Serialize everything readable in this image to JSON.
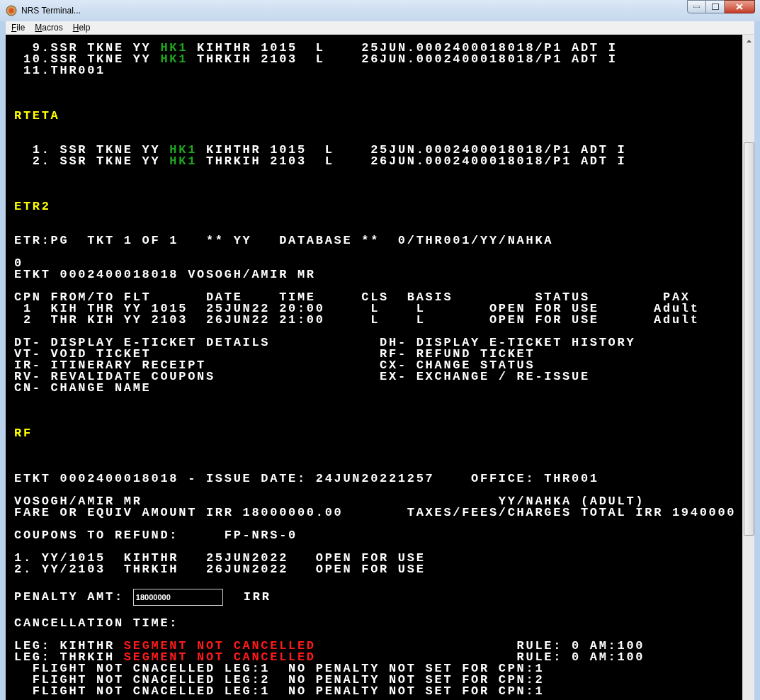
{
  "window": {
    "title": "NRS Terminal..."
  },
  "menu": [
    "File",
    "Macros",
    "Help"
  ],
  "screen": [
    {
      "kind": "text",
      "lines": [
        [
          {
            "kind": "plain",
            "text": "  9.SSR TKNE YY "
          },
          {
            "kind": "status",
            "text": "HK1"
          },
          {
            "kind": "plain",
            "text": " KIHTHR 1015  L    25JUN.0002400018018/P1 ADT I"
          }
        ],
        [
          {
            "kind": "plain",
            "text": " 10.SSR TKNE YY "
          },
          {
            "kind": "status",
            "text": "HK1"
          },
          {
            "kind": "plain",
            "text": " THRKIH 2103  L    26JUN.0002400018018/P1 ADT I"
          }
        ],
        [
          {
            "kind": "plain",
            "text": " 11.THR001"
          }
        ]
      ]
    },
    {
      "kind": "heading",
      "text": "RTETA"
    },
    {
      "kind": "text",
      "lines": [
        [
          {
            "kind": "plain",
            "text": "  1. SSR TKNE YY "
          },
          {
            "kind": "status",
            "text": "HK1"
          },
          {
            "kind": "plain",
            "text": " KIHTHR 1015  L    25JUN.0002400018018/P1 ADT I"
          }
        ],
        [
          {
            "kind": "plain",
            "text": "  2. SSR TKNE YY "
          },
          {
            "kind": "status",
            "text": "HK1"
          },
          {
            "kind": "plain",
            "text": " THRKIH 2103  L    26JUN.0002400018018/P1 ADT I"
          }
        ]
      ]
    },
    {
      "kind": "heading",
      "text": "ETR2"
    },
    {
      "kind": "text",
      "lines": [
        [
          {
            "kind": "plain",
            "text": "ETR:PG  TKT 1 OF 1   ** YY   DATABASE **  0/THR001/YY/NAHKA"
          }
        ]
      ]
    },
    {
      "kind": "text",
      "lines": [
        [
          {
            "kind": "plain",
            "text": "0"
          }
        ],
        [
          {
            "kind": "plain",
            "text": "ETKT 0002400018018 VOSOGH/AMIR MR"
          }
        ]
      ]
    },
    {
      "kind": "text",
      "lines": [
        [
          {
            "kind": "plain",
            "text": "CPN FROM/TO FLT      DATE    TIME     CLS  BASIS         STATUS        PAX"
          }
        ],
        [
          {
            "kind": "plain",
            "text": " 1  KIH THR YY 1015  25JUN22 20:00     L    L       OPEN FOR USE      Adult"
          }
        ],
        [
          {
            "kind": "plain",
            "text": " 2  THR KIH YY 2103  26JUN22 21:00     L    L       OPEN FOR USE      Adult"
          }
        ]
      ]
    },
    {
      "kind": "text",
      "lines": [
        [
          {
            "kind": "plain",
            "text": "DT- DISPLAY E-TICKET DETAILS            "
          },
          {
            "kind": "plain",
            "text": "DH- DISPLAY E-TICKET HISTORY"
          }
        ],
        [
          {
            "kind": "plain",
            "text": "VT- VOID TICKET                         "
          },
          {
            "kind": "plain",
            "text": "RF- REFUND TICKET"
          }
        ],
        [
          {
            "kind": "plain",
            "text": "IR- ITINERARY RECEIPT                   "
          },
          {
            "kind": "plain",
            "text": "CX- CHANGE STATUS"
          }
        ],
        [
          {
            "kind": "plain",
            "text": "RV- REVALIDATE COUPONS                  "
          },
          {
            "kind": "plain",
            "text": "EX- EXCHANGE / RE-ISSUE"
          }
        ],
        [
          {
            "kind": "plain",
            "text": "CN- CHANGE NAME"
          }
        ]
      ]
    },
    {
      "kind": "heading",
      "text": "RF"
    },
    {
      "kind": "report",
      "lines": [
        [
          {
            "kind": "plain",
            "text": "ETKT 0002400018018 - ISSUE DATE: 24JUN20221257    OFFICE: THR001"
          }
        ]
      ]
    },
    {
      "kind": "text",
      "lines": [
        [
          {
            "kind": "plain",
            "text": "VOSOGH/AMIR MR                                       "
          },
          {
            "kind": "plain",
            "text": "YY/NAHKA (ADULT)"
          }
        ],
        [
          {
            "kind": "plain",
            "text": "FARE OR EQUIV AMOUNT IRR 18000000.00       "
          },
          {
            "kind": "plain",
            "text": "TAXES/FEES/CHARGES TOTAL IRR 1940000"
          }
        ]
      ]
    },
    {
      "kind": "text",
      "lines": [
        [
          {
            "kind": "plain",
            "text": "COUPONS TO REFUND:     FP-NRS-0"
          }
        ]
      ]
    },
    {
      "kind": "text",
      "lines": [
        [
          {
            "kind": "plain",
            "text": "1. YY/1015  KIHTHR   25JUN2022   OPEN FOR USE"
          }
        ],
        [
          {
            "kind": "plain",
            "text": "2. YY/2103  THRKIH   26JUN2022   OPEN FOR USE"
          }
        ]
      ]
    },
    {
      "kind": "field",
      "label": "PENALTY AMT:",
      "value": "18000000",
      "unit": "IRR"
    },
    {
      "kind": "text",
      "lines": [
        [
          {
            "kind": "plain",
            "text": "CANCELLATION TIME:"
          }
        ]
      ]
    },
    {
      "kind": "text",
      "lines": [
        [
          {
            "kind": "plain",
            "text": "LEG: KIHTHR "
          },
          {
            "kind": "alert",
            "text": "SEGMENT NOT CANCELLED"
          },
          {
            "kind": "plain",
            "text": "                      RULE: 0 AM:100"
          }
        ],
        [
          {
            "kind": "plain",
            "text": "LEG: THRKIH "
          },
          {
            "kind": "alert",
            "text": "SEGMENT NOT CANCELLED"
          },
          {
            "kind": "plain",
            "text": "                      RULE: 0 AM:100"
          }
        ],
        [
          {
            "kind": "plain",
            "text": "  FLIGHT NOT CNACELLED LEG:1  NO PENALTY NOT SET FOR CPN:1"
          }
        ],
        [
          {
            "kind": "plain",
            "text": "  FLIGHT NOT CNACELLED LEG:2  NO PENALTY NOT SET FOR CPN:2"
          }
        ],
        [
          {
            "kind": "plain",
            "text": "  FLIGHT NOT CNACELLED LEG:1  NO PENALTY NOT SET FOR CPN:1"
          }
        ]
      ]
    }
  ]
}
